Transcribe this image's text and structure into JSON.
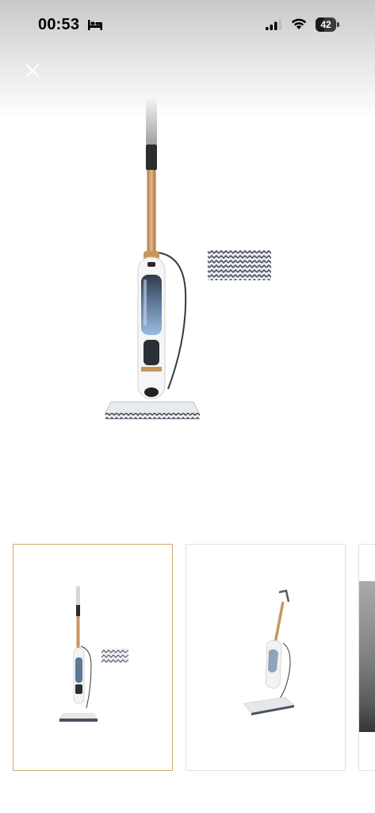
{
  "status_bar": {
    "time": "00:53",
    "battery_label": "42",
    "battery_level": 0.42,
    "icons": [
      "bed-icon",
      "cellular-signal-icon",
      "wifi-icon",
      "battery-icon"
    ]
  },
  "header": {
    "close_icon": "close-icon"
  },
  "gallery": {
    "main_image": "steam-mop-with-pad",
    "thumbnails": [
      {
        "image": "steam-mop-with-pad",
        "selected": true
      },
      {
        "image": "steam-mop-angled",
        "selected": false
      },
      {
        "image": "steam-mop-in-room",
        "selected": false
      }
    ]
  },
  "colors": {
    "selected_border": "#d7a86a",
    "copper_accent": "#c9965f"
  }
}
